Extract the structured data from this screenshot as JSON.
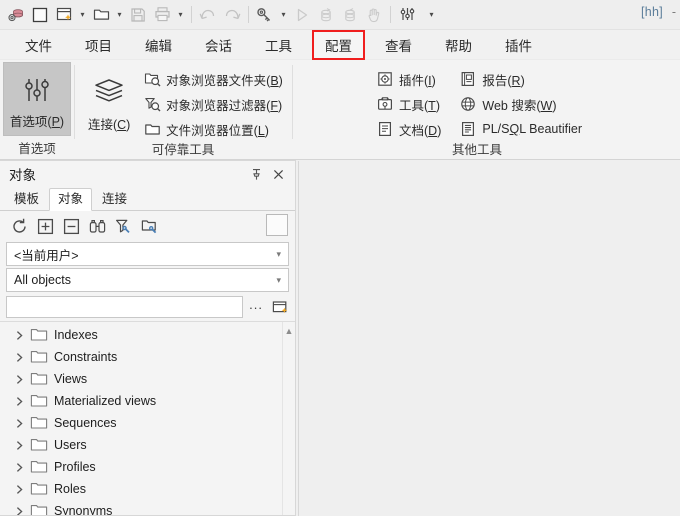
{
  "window": {
    "right_badge": "[hh]",
    "right_dash": "-"
  },
  "quick_toolbar": {
    "items": [
      {
        "name": "database-gear-icon",
        "label": "数据库设置"
      },
      {
        "name": "new-window-icon",
        "label": "新建窗口"
      },
      {
        "name": "new-document-icon",
        "label": "新建"
      },
      {
        "name": "open-folder-icon",
        "label": "打开"
      },
      {
        "name": "save-icon",
        "label": "保存"
      },
      {
        "name": "print-icon",
        "label": "打印"
      },
      {
        "name": "undo-icon",
        "label": "撤消"
      },
      {
        "name": "redo-icon",
        "label": "重做"
      },
      {
        "name": "key-icon",
        "label": "登录"
      },
      {
        "name": "execute-icon",
        "label": "执行"
      },
      {
        "name": "commit-icon",
        "label": "提交"
      },
      {
        "name": "rollback-icon",
        "label": "回滚"
      },
      {
        "name": "break-icon",
        "label": "中断"
      },
      {
        "name": "preferences-icon",
        "label": "首选项"
      },
      {
        "name": "overflow-caret-icon",
        "label": "更多"
      }
    ]
  },
  "menubar": {
    "items": [
      {
        "label": "文件",
        "highlighted": false
      },
      {
        "label": "项目",
        "highlighted": false
      },
      {
        "label": "编辑",
        "highlighted": false
      },
      {
        "label": "会话",
        "highlighted": false
      },
      {
        "label": "工具",
        "highlighted": false
      },
      {
        "label": "配置",
        "highlighted": true
      },
      {
        "label": "查看",
        "highlighted": false
      },
      {
        "label": "帮助",
        "highlighted": false
      },
      {
        "label": "插件",
        "highlighted": false
      }
    ],
    "highlight_color": "#f01e1e"
  },
  "ribbon": {
    "groups": [
      {
        "label": "首选项",
        "big_button": {
          "label_pre": "首选项(",
          "accel": "P",
          "label_post": ")",
          "icon": "sliders-icon",
          "selected": true
        }
      },
      {
        "label": "可停靠工具",
        "med_button": {
          "label_pre": "连接(",
          "accel": "C",
          "label_post": ")",
          "icon": "layers-icon"
        },
        "small_buttons": [
          {
            "label_pre": "对象浏览器文件夹(",
            "accel": "B",
            "label_post": ")",
            "icon": "object-browser-folder-icon"
          },
          {
            "label_pre": "对象浏览器过滤器(",
            "accel": "F",
            "label_post": ")",
            "icon": "object-browser-filter-icon"
          },
          {
            "label_pre": "文件浏览器位置(",
            "accel": "L",
            "label_post": ")",
            "icon": "file-browser-location-icon"
          }
        ]
      },
      {
        "label": "其他工具",
        "small_buttons_col1": [
          {
            "label_pre": "插件(",
            "accel": "I",
            "label_post": ")",
            "icon": "plugin-icon"
          },
          {
            "label_pre": "工具(",
            "accel": "T",
            "label_post": ")",
            "icon": "toolbox-icon"
          },
          {
            "label_pre": "文档(",
            "accel": "D",
            "label_post": ")",
            "icon": "document-icon"
          }
        ],
        "small_buttons_col2": [
          {
            "label_pre": "报告(",
            "accel": "R",
            "label_post": ")",
            "icon": "report-icon"
          },
          {
            "label_pre": "Web 搜索(",
            "accel": "W",
            "label_post": ")",
            "icon": "web-search-icon"
          },
          {
            "label_pre": "PL/S",
            "accel": "Q",
            "label_post": "L Beautifier",
            "icon": "beautifier-icon"
          }
        ]
      }
    ]
  },
  "object_panel": {
    "title": "对象",
    "pin_icon": "pin-icon",
    "close_icon": "close-icon",
    "tabs": [
      {
        "label": "模板",
        "active": false
      },
      {
        "label": "对象",
        "active": true
      },
      {
        "label": "连接",
        "active": false
      }
    ],
    "toolbar_icons": [
      {
        "name": "refresh-icon",
        "label": "刷新"
      },
      {
        "name": "expand-all-icon",
        "label": "全部展开"
      },
      {
        "name": "collapse-all-icon",
        "label": "全部折叠"
      },
      {
        "name": "find-binoculars-icon",
        "label": "查找"
      },
      {
        "name": "filter-icon",
        "label": "过滤器"
      },
      {
        "name": "folder-config-icon",
        "label": "文件夹"
      }
    ],
    "user_combo": {
      "value": "<当前用户>"
    },
    "objects_combo": {
      "value": "All objects"
    },
    "search": {
      "value": "",
      "placeholder": ""
    },
    "search_more_label": "...",
    "search_new_window_icon": "new-window-icon",
    "tree_scroll_up_icon": "scroll-up-arrow-icon",
    "tree": [
      {
        "label": "Indexes",
        "icon": "folder-icon",
        "expander": "chevron-right-icon"
      },
      {
        "label": "Constraints",
        "icon": "folder-icon",
        "expander": "chevron-right-icon"
      },
      {
        "label": "Views",
        "icon": "folder-icon",
        "expander": "chevron-right-icon"
      },
      {
        "label": "Materialized views",
        "icon": "folder-icon",
        "expander": "chevron-right-icon"
      },
      {
        "label": "Sequences",
        "icon": "folder-icon",
        "expander": "chevron-right-icon"
      },
      {
        "label": "Users",
        "icon": "folder-icon",
        "expander": "chevron-right-icon"
      },
      {
        "label": "Profiles",
        "icon": "folder-icon",
        "expander": "chevron-right-icon"
      },
      {
        "label": "Roles",
        "icon": "folder-icon",
        "expander": "chevron-right-icon"
      },
      {
        "label": "Synonyms",
        "icon": "folder-icon",
        "expander": "chevron-right-icon"
      }
    ]
  },
  "colors": {
    "accent": "#5b7d9a",
    "highlight_red": "#f01e1e",
    "ribbon_bg": "#f3f3f3",
    "panel_bg": "#f4f4f4",
    "selected_button": "#c6c6c6"
  }
}
